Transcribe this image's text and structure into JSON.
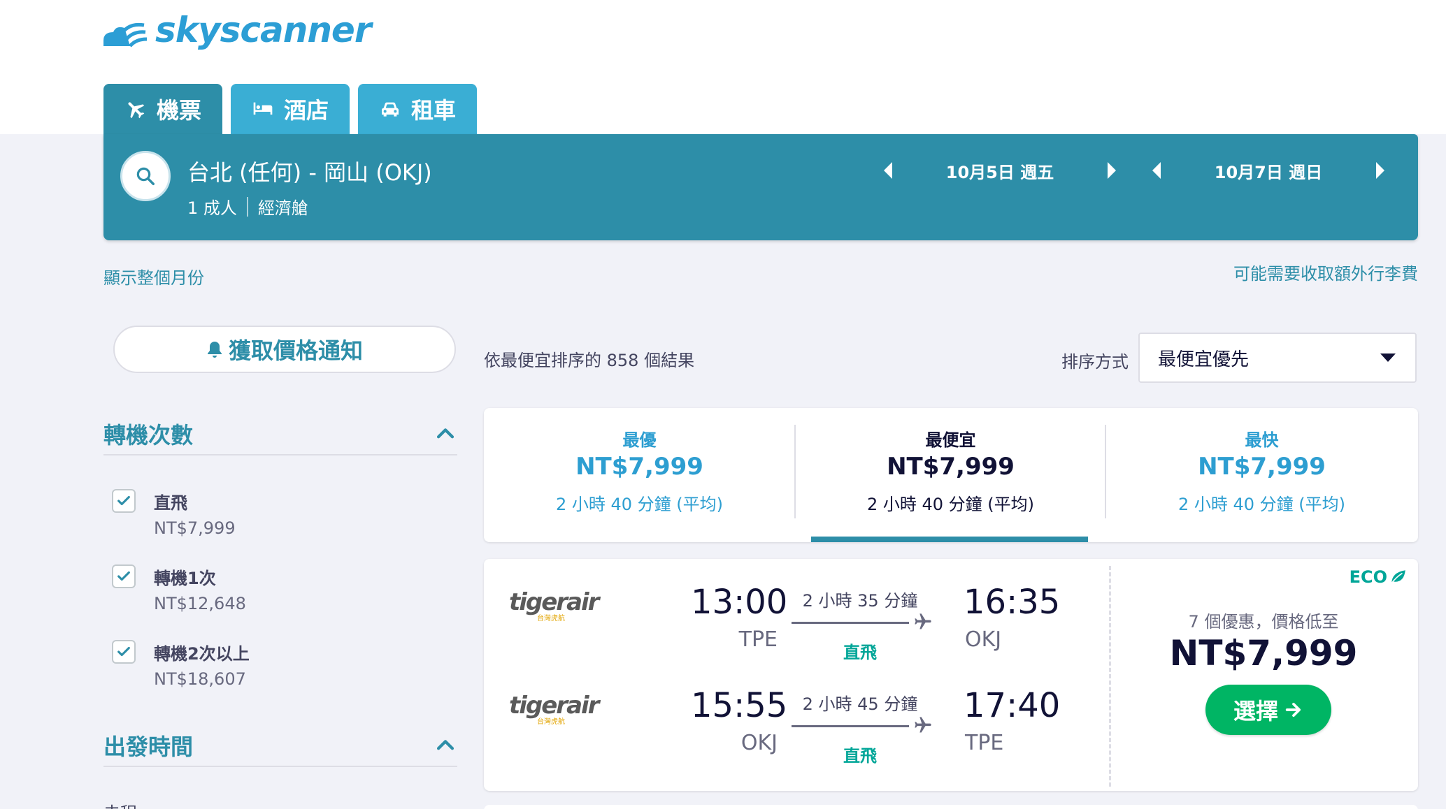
{
  "brand": {
    "name": "skyscanner",
    "color": "#2c9ed5"
  },
  "tabs": [
    {
      "label": "機票",
      "icon": "plane-icon",
      "active": true
    },
    {
      "label": "酒店",
      "icon": "bed-icon",
      "active": false
    },
    {
      "label": "租車",
      "icon": "car-icon",
      "active": false
    }
  ],
  "search": {
    "route": "台北 (任何) - 岡山 (OKJ)",
    "travellers": "1 成人",
    "cabin": "經濟艙",
    "depart_date": "10月5日 週五",
    "return_date": "10月7日 週日"
  },
  "links": {
    "show_month": "顯示整個月份",
    "baggage_fee": "可能需要收取額外行李費"
  },
  "price_alert": {
    "label": "獲取價格通知"
  },
  "filters": {
    "stops": {
      "title": "轉機次數",
      "options": [
        {
          "label": "直飛",
          "price": "NT$7,999",
          "checked": true
        },
        {
          "label": "轉機1次",
          "price": "NT$12,648",
          "checked": true
        },
        {
          "label": "轉機2次以上",
          "price": "NT$18,607",
          "checked": true
        }
      ]
    },
    "departure": {
      "title": "出發時間",
      "next_label": "去程"
    }
  },
  "results": {
    "count_text": "依最便宜排序的 858 個結果",
    "sort_label": "排序方式",
    "sort_value": "最便宜優先"
  },
  "sort_tabs": [
    {
      "title": "最優",
      "price": "NT$7,999",
      "duration": "2 小時 40 分鐘 (平均)",
      "active": false
    },
    {
      "title": "最便宜",
      "price": "NT$7,999",
      "duration": "2 小時 40 分鐘 (平均)",
      "active": true
    },
    {
      "title": "最快",
      "price": "NT$7,999",
      "duration": "2 小時 40 分鐘 (平均)",
      "active": false
    }
  ],
  "flight_card": {
    "legs": [
      {
        "airline": "tigerair",
        "airline_sub": "台灣虎航",
        "dep_time": "13:00",
        "dep_code": "TPE",
        "duration": "2 小時 35 分鐘",
        "stops": "直飛",
        "arr_time": "16:35",
        "arr_code": "OKJ"
      },
      {
        "airline": "tigerair",
        "airline_sub": "台灣虎航",
        "dep_time": "15:55",
        "dep_code": "OKJ",
        "duration": "2 小時 45 分鐘",
        "stops": "直飛",
        "arr_time": "17:40",
        "arr_code": "TPE"
      }
    ],
    "eco_label": "ECO",
    "deals_text": "7 個優惠，價格低至",
    "price": "NT$7,999",
    "select_label": "選擇"
  },
  "colors": {
    "primary": "#2d8ea8",
    "tab_inactive": "#3aaed4",
    "link_blue": "#2d9ed1",
    "green": "#00b564",
    "eco": "#00a698"
  }
}
